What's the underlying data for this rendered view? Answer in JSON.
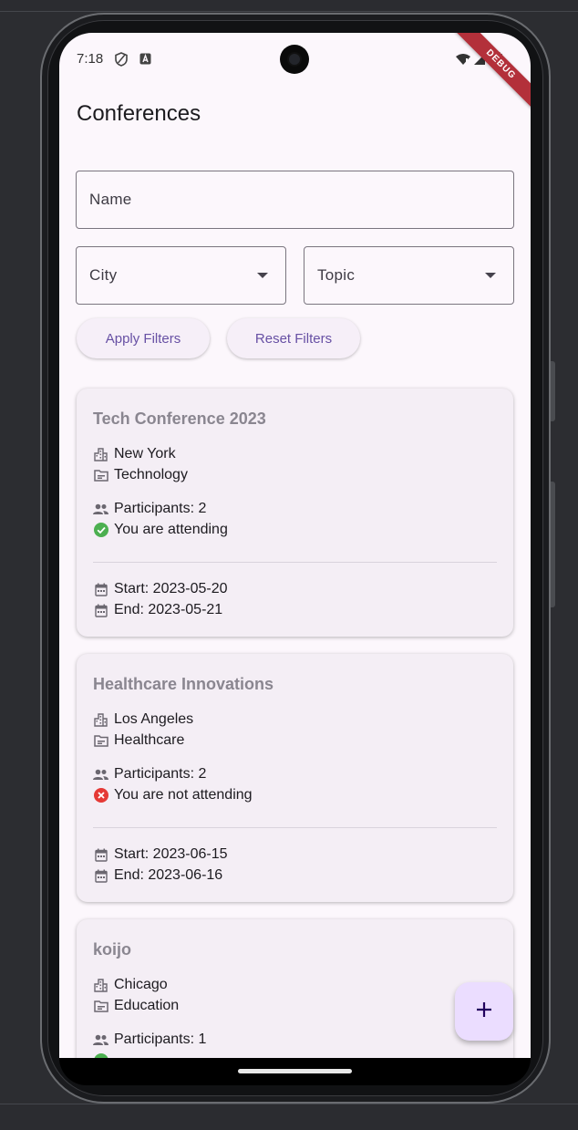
{
  "status_bar": {
    "time": "7:18",
    "debug_banner": "DEBUG"
  },
  "page": {
    "title": "Conferences"
  },
  "filters": {
    "name_label": "Name",
    "city_label": "City",
    "topic_label": "Topic",
    "apply_label": "Apply Filters",
    "reset_label": "Reset Filters"
  },
  "conferences": [
    {
      "title": "Tech Conference 2023",
      "city": "New York",
      "topic": "Technology",
      "participants": "Participants: 2",
      "attendance": "You are attending",
      "attending": true,
      "start": "Start: 2023-05-20",
      "end": "End: 2023-05-21"
    },
    {
      "title": "Healthcare Innovations",
      "city": "Los Angeles",
      "topic": "Healthcare",
      "participants": "Participants: 2",
      "attendance": "You are not attending",
      "attending": false,
      "start": "Start: 2023-06-15",
      "end": "End: 2023-06-16"
    },
    {
      "title": "koijo",
      "city": "Chicago",
      "topic": "Education",
      "participants": "Participants: 1",
      "attendance": "",
      "attending": true,
      "start": "",
      "end": ""
    }
  ],
  "colors": {
    "primary": "#6750a4",
    "attending": "#4caf50",
    "not_attending": "#e53935",
    "fab_background": "#ebddff"
  },
  "icons": {
    "city": "location-city-icon",
    "topic": "topic-folder-icon",
    "participants": "people-icon",
    "attending": "check-circle-icon",
    "not_attending": "cancel-icon",
    "date": "calendar-icon",
    "fab": "add-icon"
  }
}
